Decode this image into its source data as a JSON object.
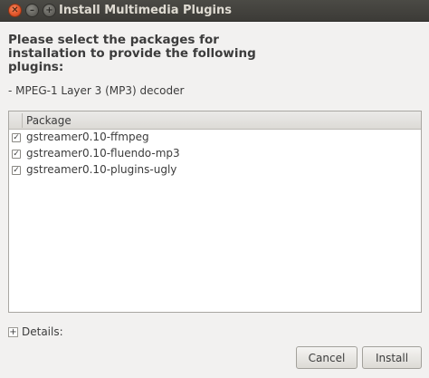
{
  "window": {
    "title": "Install Multimedia Plugins",
    "close_glyph": "✕",
    "min_glyph": "–",
    "max_glyph": "+"
  },
  "dialog": {
    "heading": "Please select the packages for\ninstallation to provide the following\nplugins:",
    "plugin": "- MPEG-1 Layer 3 (MP3) decoder"
  },
  "packages": {
    "column_header": "Package",
    "items": [
      {
        "name": "gstreamer0.10-ffmpeg",
        "checked": true
      },
      {
        "name": "gstreamer0.10-fluendo-mp3",
        "checked": true
      },
      {
        "name": "gstreamer0.10-plugins-ugly",
        "checked": true
      }
    ]
  },
  "details": {
    "expander_glyph": "+",
    "label": "Details:"
  },
  "buttons": {
    "cancel": "Cancel",
    "install": "Install"
  },
  "icons": {
    "close": "close-icon",
    "minimize": "minimize-icon",
    "maximize": "maximize-icon",
    "checkbox": "checkmark-icon",
    "expander": "expander-plus-icon"
  }
}
